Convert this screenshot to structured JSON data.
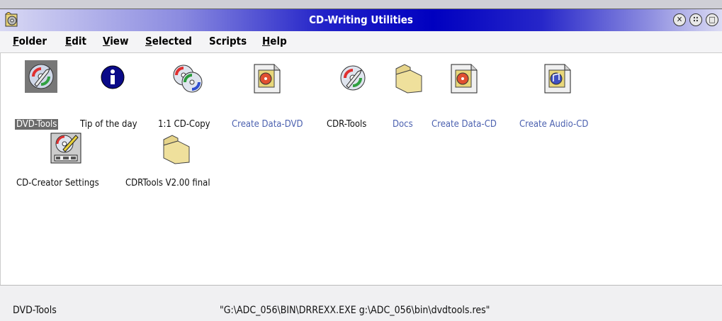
{
  "window": {
    "title": "CD-Writing Utilities"
  },
  "menu": [
    {
      "label": "Folder",
      "u": "F"
    },
    {
      "label": "Edit",
      "u": "E"
    },
    {
      "label": "View",
      "u": "V"
    },
    {
      "label": "Selected",
      "u": "S"
    },
    {
      "label": "Scripts",
      "u": ""
    },
    {
      "label": "Help",
      "u": "H"
    }
  ],
  "icons": [
    {
      "label": "DVD-Tools",
      "icon": "wrench-cd-icon",
      "selected": true,
      "link_style": false
    },
    {
      "label": "Tip of the day",
      "icon": "info-icon",
      "selected": false,
      "link_style": false
    },
    {
      "label": "1:1 CD-Copy",
      "icon": "cd-copy-icon",
      "selected": false,
      "link_style": false
    },
    {
      "label": "Create Data-DVD",
      "icon": "create-disc-icon",
      "selected": false,
      "link_style": true
    },
    {
      "label": "CDR-Tools",
      "icon": "wrench-cd-icon",
      "selected": false,
      "link_style": false
    },
    {
      "label": "Docs",
      "icon": "folder-icon",
      "selected": false,
      "link_style": true
    },
    {
      "label": "Create Data-CD",
      "icon": "create-disc-icon",
      "selected": false,
      "link_style": true
    },
    {
      "label": "Create Audio-CD",
      "icon": "create-audio-icon",
      "selected": false,
      "link_style": true
    },
    {
      "label": "CD-Creator Settings",
      "icon": "settings-icon",
      "selected": false,
      "link_style": false
    },
    {
      "label": "CDRTools V2.00 final",
      "icon": "folder-icon",
      "selected": false,
      "link_style": false
    }
  ],
  "status": {
    "selected_name": "DVD-Tools",
    "command": "\"G:\\ADC_056\\BIN\\DRREXX.EXE g:\\ADC_056\\bin\\dvdtools.res\""
  },
  "window_buttons": [
    "close-button",
    "hide-button",
    "maximize-button"
  ]
}
